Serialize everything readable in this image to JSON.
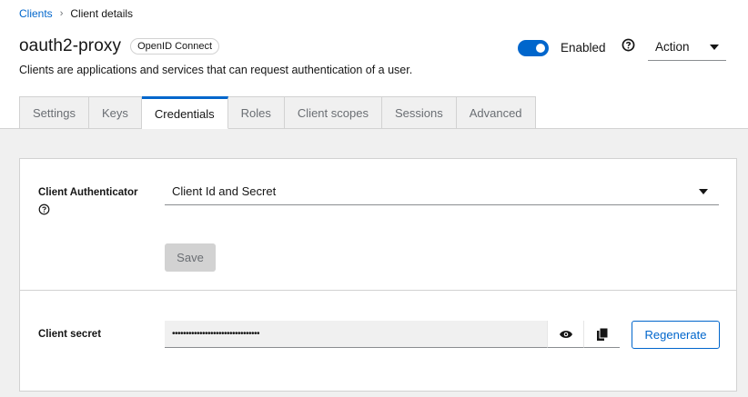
{
  "breadcrumb": {
    "parent": "Clients",
    "separator": "›",
    "current": "Client details"
  },
  "header": {
    "title": "oauth2-proxy",
    "badge": "OpenID Connect",
    "subtitle": "Clients are applications and services that can request authentication of a user.",
    "enabled_label": "Enabled",
    "enabled": true,
    "action_label": "Action"
  },
  "tabs": [
    {
      "label": "Settings",
      "active": false
    },
    {
      "label": "Keys",
      "active": false
    },
    {
      "label": "Credentials",
      "active": true
    },
    {
      "label": "Roles",
      "active": false
    },
    {
      "label": "Client scopes",
      "active": false
    },
    {
      "label": "Sessions",
      "active": false
    },
    {
      "label": "Advanced",
      "active": false
    }
  ],
  "credentials": {
    "authenticator_label": "Client Authenticator",
    "authenticator_value": "Client Id and Secret",
    "save_label": "Save",
    "secret_label": "Client secret",
    "secret_masked": "••••••••••••••••••••••••••••••••",
    "regenerate_label": "Regenerate"
  },
  "icons": {
    "help": "help-icon",
    "caret": "caret-down-icon",
    "eye": "eye-icon",
    "copy": "copy-icon"
  },
  "colors": {
    "accent": "#0066cc",
    "border": "#d2d2d2",
    "muted": "#6a6e73",
    "background": "#f0f0f0"
  }
}
